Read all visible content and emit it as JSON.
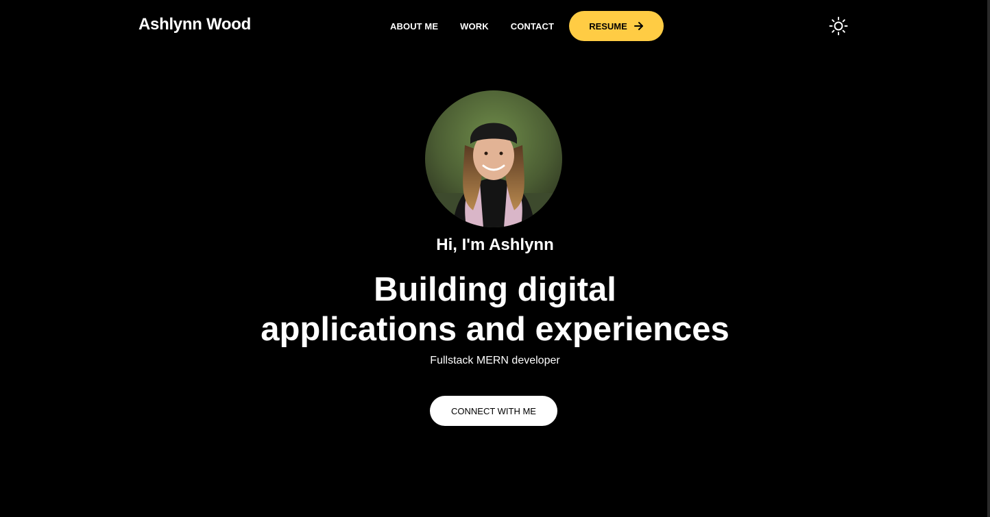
{
  "header": {
    "brand": "Ashlynn Wood",
    "nav": [
      {
        "label": "ABOUT ME"
      },
      {
        "label": "WORK"
      },
      {
        "label": "CONTACT"
      }
    ],
    "resume_label": "RESUME",
    "resume_icon": "arrow-right-icon",
    "theme_icon": "sun-icon"
  },
  "hero": {
    "greeting": "Hi, I'm Ashlynn",
    "headline_line1": "Building digital",
    "headline_line2": "applications and experiences",
    "subtitle": "Fullstack MERN developer",
    "cta_label": "CONNECT WITH ME"
  },
  "colors": {
    "background": "#000000",
    "accent": "#ffcc44",
    "text": "#ffffff"
  }
}
